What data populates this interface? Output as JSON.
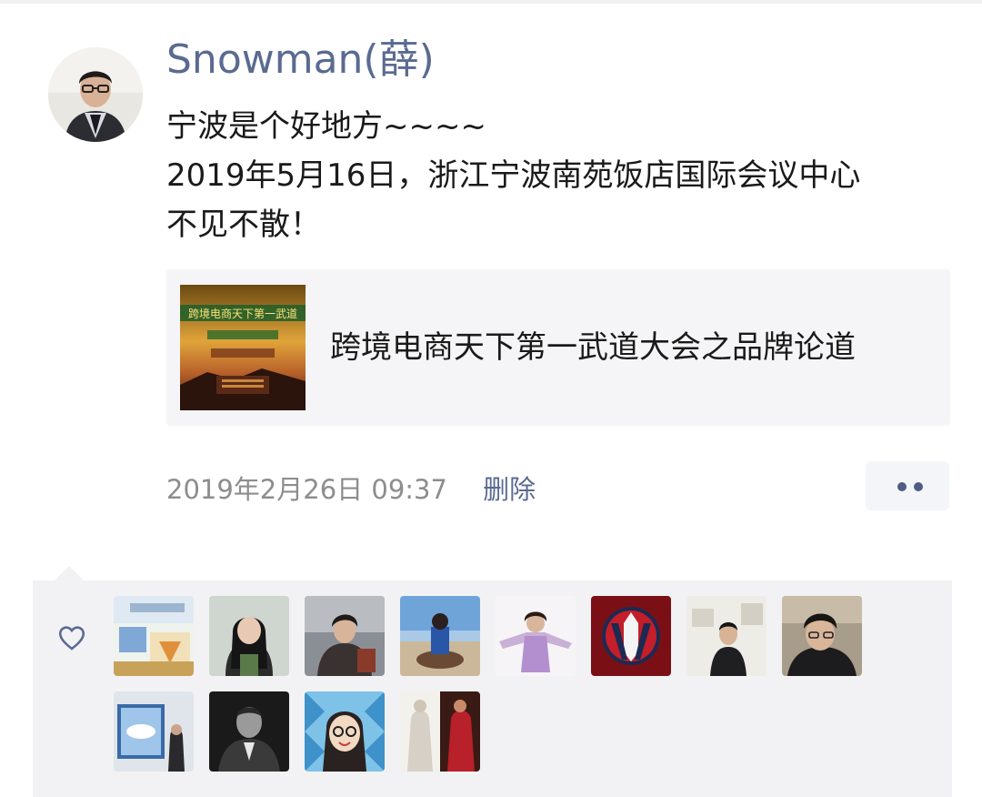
{
  "post": {
    "author_name": "Snowman(薛)",
    "text_lines": [
      "宁波是个好地方~~~~",
      "2019年5月16日，浙江宁波南苑饭店国际会议中心",
      "不见不散！"
    ],
    "link": {
      "title": "跨境电商天下第一武道大会之品牌论道",
      "thumbnail_text": "跨境电商天下第一武道"
    },
    "timestamp": "2019年2月26日 09:37",
    "delete_label": "删除"
  },
  "likes": {
    "icon": "heart-outline-icon",
    "count_avatars": 12
  },
  "colors": {
    "name_blue": "#5a6a91",
    "meta_gray": "#8d8d8d",
    "panel_bg": "#f2f2f4",
    "card_bg": "#f5f5f7"
  }
}
